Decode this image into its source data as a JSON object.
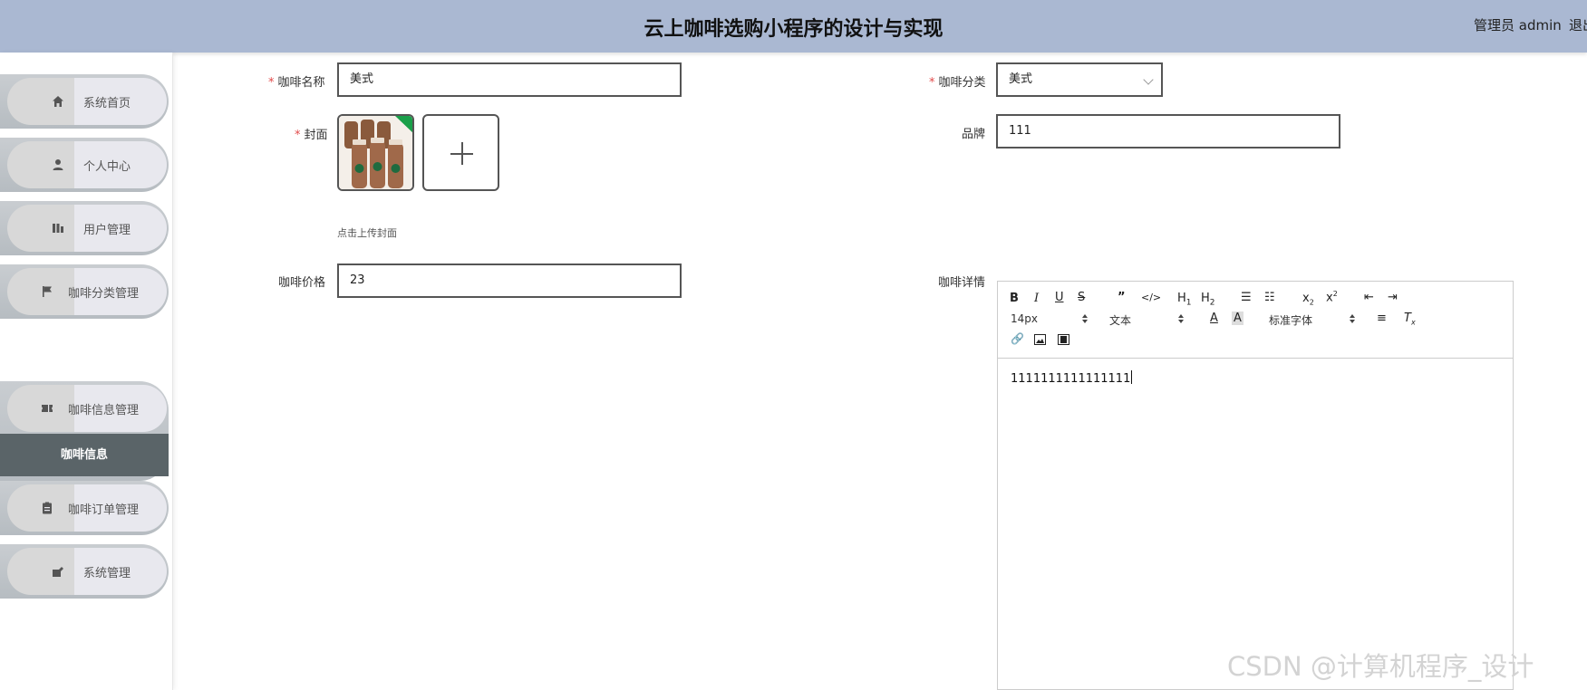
{
  "header": {
    "title": "云上咖啡选购小程序的设计与实现",
    "user": "管理员 admin",
    "logout": "退出"
  },
  "sidebar": {
    "items": [
      {
        "label": "系统首页",
        "icon": "home-icon"
      },
      {
        "label": "个人中心",
        "icon": "person-icon"
      },
      {
        "label": "用户管理",
        "icon": "users-icon"
      },
      {
        "label": "咖啡分类管理",
        "icon": "flag-icon"
      },
      {
        "label": "咖啡信息管理",
        "icon": "ticket-icon"
      },
      {
        "label": "咖啡订单管理",
        "icon": "clipboard-icon"
      },
      {
        "label": "系统管理",
        "icon": "settings-icon"
      }
    ],
    "sub_item": "咖啡信息"
  },
  "form": {
    "name_label": "咖啡名称",
    "name_value": "美式",
    "category_label": "咖啡分类",
    "category_value": "美式",
    "cover_label": "封面",
    "cover_hint": "点击上传封面",
    "brand_label": "品牌",
    "brand_value": "111",
    "price_label": "咖啡价格",
    "price_value": "23",
    "detail_label": "咖啡详情"
  },
  "editor": {
    "font_size": "14px",
    "heading": "文本",
    "font_family": "标准字体",
    "content": "1111111111111111"
  },
  "watermark": "CSDN @计算机程序_设计"
}
